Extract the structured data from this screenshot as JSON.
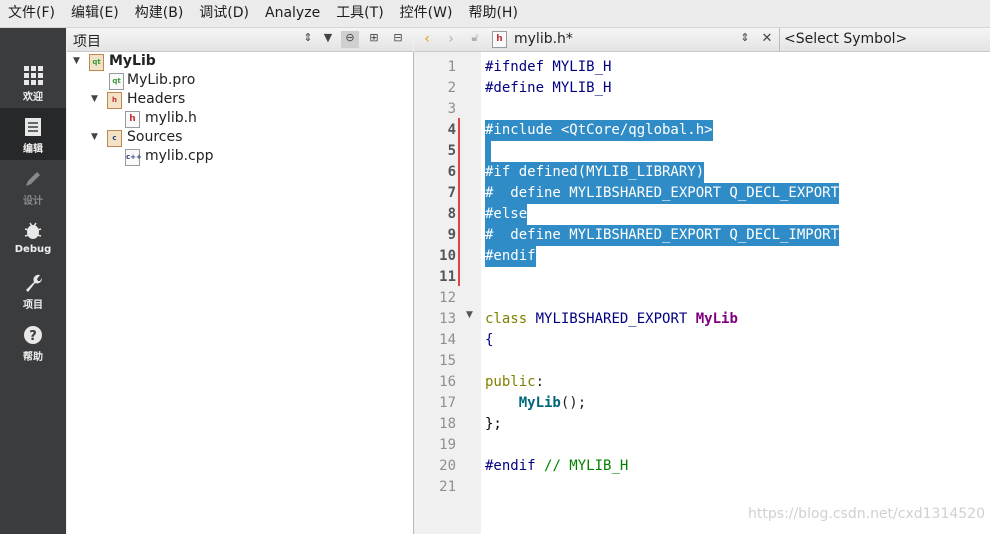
{
  "menubar": [
    "文件(F)",
    "编辑(E)",
    "构建(B)",
    "调试(D)",
    "Analyze",
    "工具(T)",
    "控件(W)",
    "帮助(H)"
  ],
  "modes": [
    {
      "label": "欢迎",
      "icon": "grid-icon",
      "active": false,
      "enabled": true
    },
    {
      "label": "编辑",
      "icon": "document-icon",
      "active": true,
      "enabled": true
    },
    {
      "label": "设计",
      "icon": "pencil-icon",
      "active": false,
      "enabled": false
    },
    {
      "label": "Debug",
      "icon": "bug-icon",
      "active": false,
      "enabled": true
    },
    {
      "label": "项目",
      "icon": "wrench-icon",
      "active": false,
      "enabled": true
    },
    {
      "label": "帮助",
      "icon": "help-icon",
      "active": false,
      "enabled": true
    }
  ],
  "project": {
    "title": "项目",
    "tree": [
      {
        "label": "MyLib",
        "bold": true,
        "depth": 0,
        "expanded": true,
        "icon": "project-folder-icon"
      },
      {
        "label": "MyLib.pro",
        "bold": false,
        "depth": 1,
        "icon": "pro-file-icon"
      },
      {
        "label": "Headers",
        "bold": false,
        "depth": 1,
        "expanded": true,
        "icon": "headers-folder-icon"
      },
      {
        "label": "mylib.h",
        "bold": false,
        "depth": 2,
        "icon": "header-file-icon"
      },
      {
        "label": "Sources",
        "bold": false,
        "depth": 1,
        "expanded": true,
        "icon": "sources-folder-icon"
      },
      {
        "label": "mylib.cpp",
        "bold": false,
        "depth": 2,
        "icon": "cpp-file-icon"
      }
    ]
  },
  "editor": {
    "filename": "mylib.h*",
    "symbol_selector": "<Select Symbol>",
    "lines": [
      "#ifndef MYLIB_H",
      "#define MYLIB_H",
      "",
      "#include <QtCore/qglobal.h>",
      "",
      "#if defined(MYLIB_LIBRARY)",
      "#  define MYLIBSHARED_EXPORT Q_DECL_EXPORT",
      "#else",
      "#  define MYLIBSHARED_EXPORT Q_DECL_IMPORT",
      "#endif",
      "",
      "",
      "class MYLIBSHARED_EXPORT MyLib",
      "{",
      "",
      "public:",
      "    MyLib();",
      "};",
      "",
      "#endif // MYLIB_H",
      ""
    ],
    "selection_color": "#308cc6"
  },
  "watermark": "https://blog.csdn.net/cxd1314520"
}
